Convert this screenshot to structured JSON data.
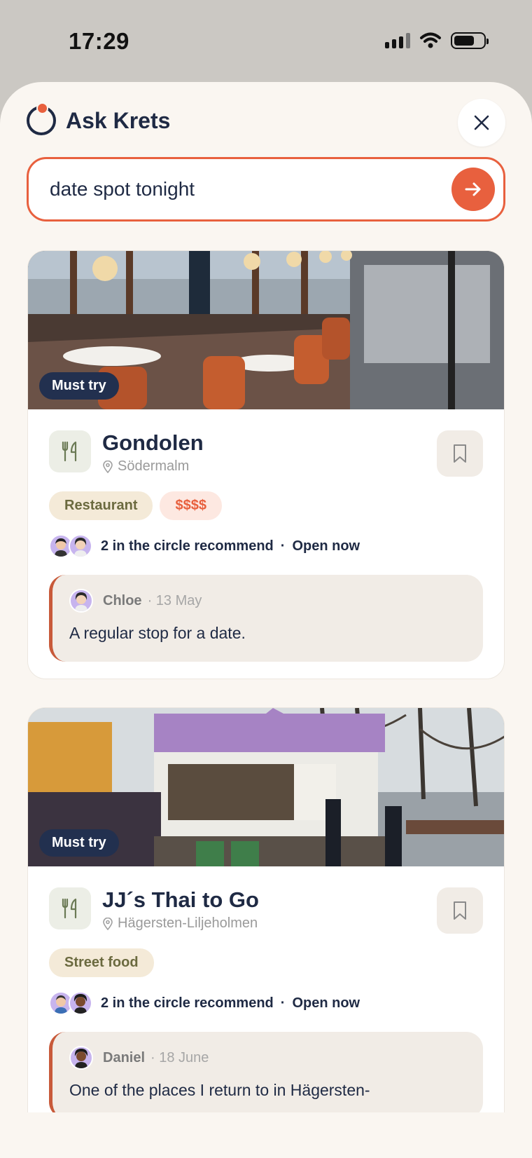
{
  "status_bar": {
    "time": "17:29",
    "battery_level": 0.7
  },
  "header": {
    "title": "Ask Krets"
  },
  "search": {
    "query": "date spot tonight"
  },
  "results": [
    {
      "photo_badge": "Must try",
      "name": "Gondolen",
      "area": "Södermalm",
      "tags": [
        "Restaurant",
        "$$$$"
      ],
      "recommend_text": "2 in the circle recommend",
      "separator": "·",
      "status": "Open now",
      "review": {
        "author": "Chloe",
        "date": "· 13 May",
        "text": "A regular stop for a date."
      }
    },
    {
      "photo_badge": "Must try",
      "name": "JJ´s Thai to Go",
      "area": "Hägersten-Liljeholmen",
      "tags": [
        "Street food"
      ],
      "recommend_text": "2 in the circle recommend",
      "separator": "·",
      "status": "Open now",
      "review": {
        "author": "Daniel",
        "date": "· 18 June",
        "text": "One of the places I return to in Hägersten-"
      }
    }
  ],
  "colors": {
    "accent": "#e8603e",
    "navy": "#1f2a44",
    "sheet": "#faf6f1",
    "badge": "#22304f"
  }
}
